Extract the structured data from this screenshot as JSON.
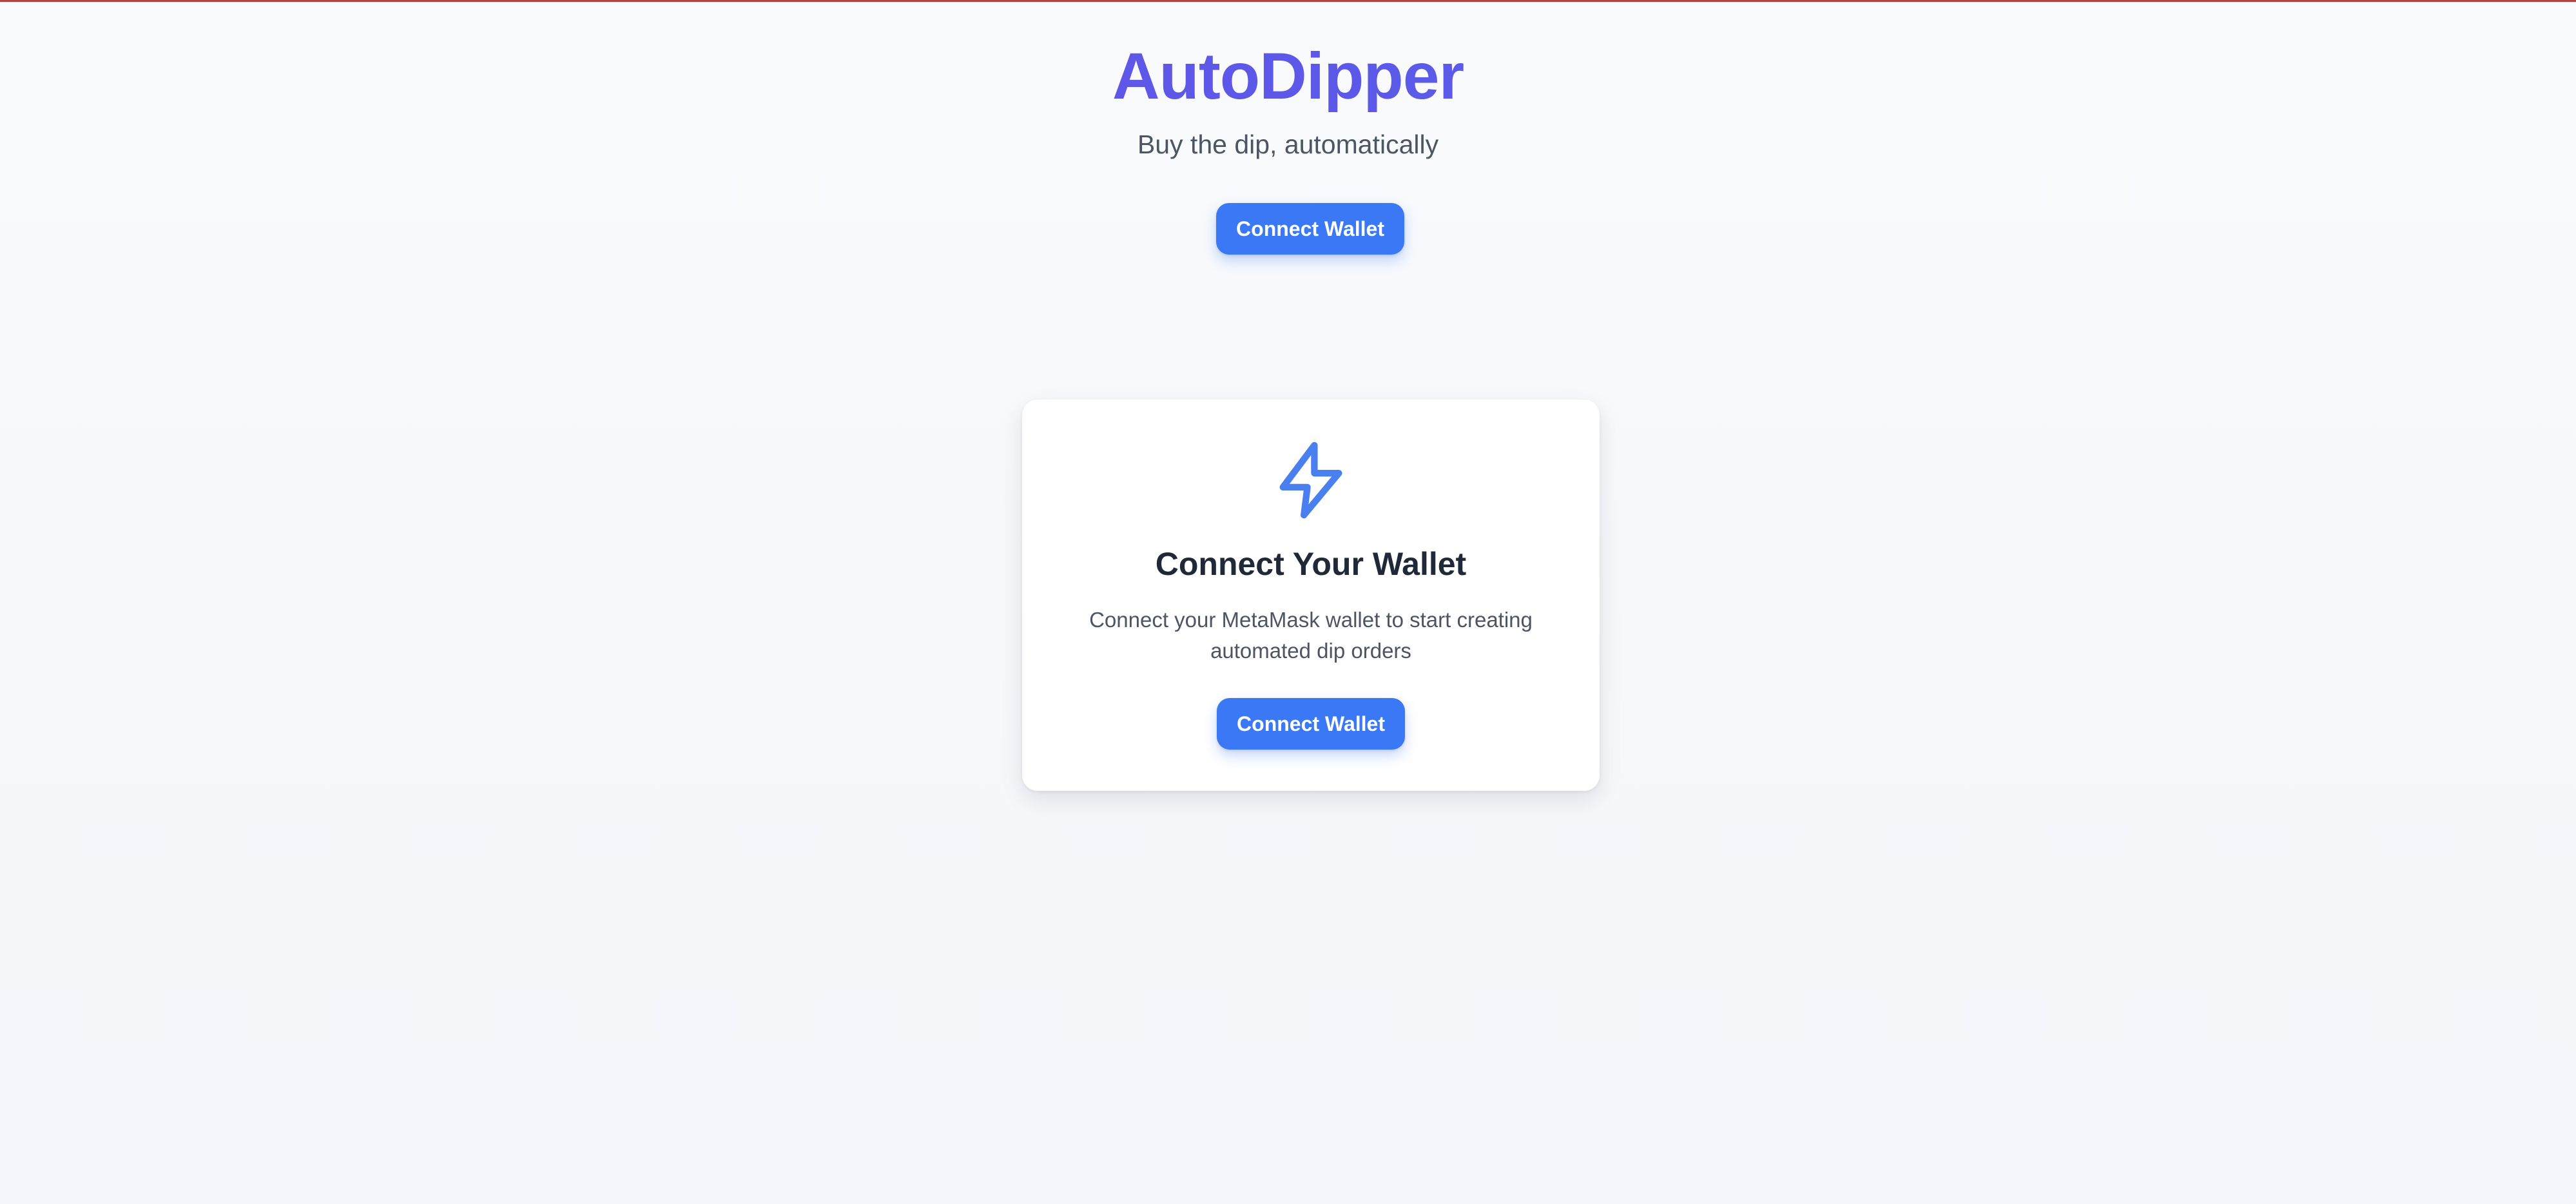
{
  "header": {
    "title": "AutoDipper",
    "tagline": "Buy the dip, automatically",
    "connect_button_label": "Connect Wallet"
  },
  "card": {
    "icon": "lightning-bolt-icon",
    "title": "Connect Your Wallet",
    "description": "Connect your MetaMask wallet to start creating automated dip orders",
    "connect_button_label": "Connect Wallet"
  },
  "colors": {
    "brand_title": "#6a4be6",
    "accent": "#3b78f6",
    "top_line": "#b44444"
  }
}
